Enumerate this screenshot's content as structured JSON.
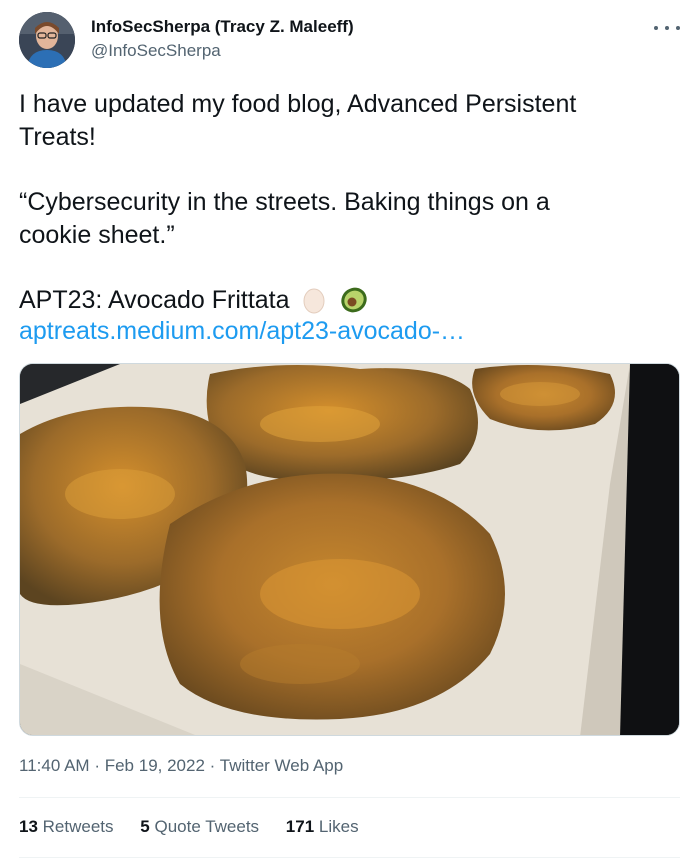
{
  "author": {
    "name": "InfoSecSherpa (Tracy Z. Maleeff)",
    "handle": "@InfoSecSherpa"
  },
  "tweet": {
    "line1": "I have updated my food blog, Advanced Persistent",
    "line2": "Treats!",
    "line3": "“Cybersecurity in the streets. Baking things on a",
    "line4": "cookie sheet.”",
    "line5": "APT23: Avocado Frittata",
    "emojis": [
      "egg-icon",
      "avocado-icon"
    ],
    "link": "aptreats.medium.com/apt23-avocado-…"
  },
  "meta": {
    "time": "11:40 AM",
    "date": "Feb 19, 2022",
    "app": "Twitter Web App",
    "sep": "·"
  },
  "stats": {
    "retweets_count": "13",
    "retweets_label": "Retweets",
    "quotes_count": "5",
    "quotes_label": "Quote Tweets",
    "likes_count": "171",
    "likes_label": "Likes"
  },
  "colors": {
    "link": "#1d9bf0",
    "secondary": "#536471",
    "text": "#0f1419"
  }
}
